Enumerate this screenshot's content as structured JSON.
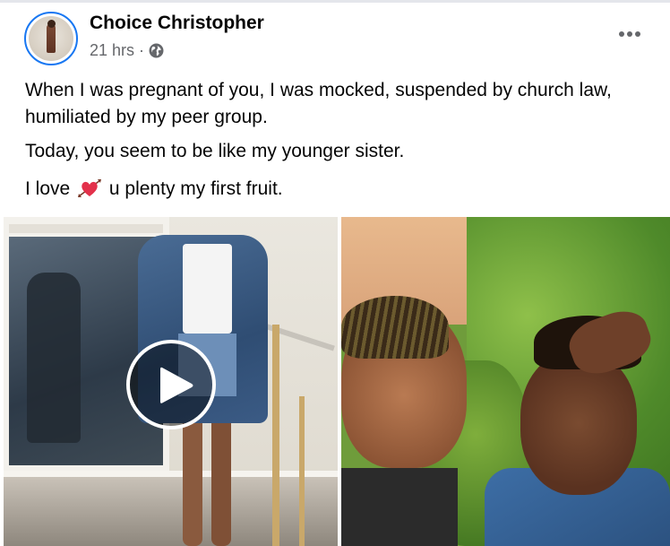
{
  "post": {
    "author": "Choice Christopher",
    "time": "21 hrs",
    "separator": "·",
    "privacy_icon": "globe-icon",
    "more_icon": "more-options-icon",
    "text_line_1": "When I was pregnant of you, I was mocked, suspended by church law, humiliated by my peer group.",
    "text_line_2": "Today, you seem to be like my younger sister.",
    "text_line_3_before": "I love",
    "text_line_3_emoji": "heart-with-arrow-icon",
    "text_line_3_after": "u plenty my first fruit."
  },
  "media": {
    "left": {
      "type": "video",
      "play_icon": "play-icon"
    },
    "right": {
      "type": "photo"
    }
  },
  "colors": {
    "accent": "#1877f2",
    "secondary_text": "#65676b",
    "primary_text": "#050505"
  }
}
